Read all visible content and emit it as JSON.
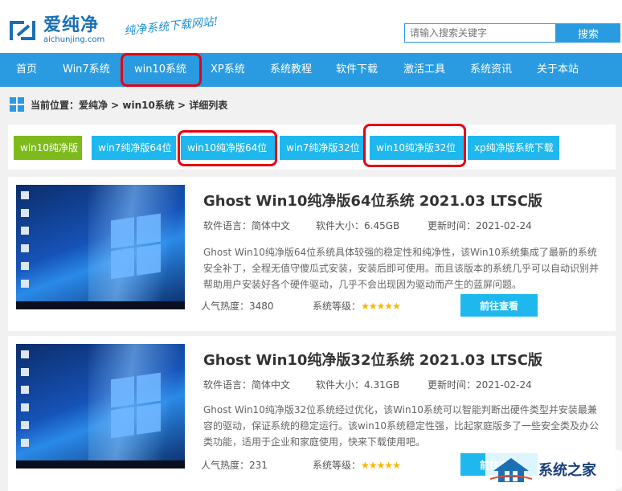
{
  "header": {
    "logo_cn": "爱纯净",
    "logo_en": "aichunjing.com",
    "slogan": "纯净系统下载网站!",
    "search_placeholder": "请输入搜索关键字",
    "search_button": "搜索"
  },
  "nav": {
    "items": [
      "首页",
      "Win7系统",
      "win10系统",
      "XP系统",
      "系统教程",
      "软件下载",
      "激活工具",
      "系统资讯",
      "关于本站"
    ],
    "active_index": 2
  },
  "breadcrumb": "当前位置：爱纯净 > win10系统 > 详细列表",
  "filters": [
    "win10纯净版",
    "win7纯净版64位",
    "win10纯净版64位",
    "win7纯净版32位",
    "win10纯净版32位",
    "xp纯净版系统下载"
  ],
  "filter_active_index": 0,
  "items": [
    {
      "title": "Ghost Win10纯净版64位系统 2021.03 LTSC版",
      "language": "软件语言：简体中文",
      "size": "软件大小：6.45GB",
      "updated": "更新时间：2021-02-24",
      "desc": "Ghost Win10纯净版64位系统具体较强的稳定性和纯净性，该Win10系统集成了最新的系统安全补丁，全程无值守傻瓜式安装，安装后即可使用。而且该版本的系统几乎可以自动识别并帮助用户安装好各个硬件驱动，几乎不会出现因为驱动而产生的蓝屏问题。",
      "heat": "人气热度：3480",
      "level_label": "系统等级：",
      "stars": "★★★★★",
      "button": "前往查看"
    },
    {
      "title": "Ghost Win10纯净版32位系统 2021.03 LTSC版",
      "language": "软件语言：简体中文",
      "size": "软件大小：4.31GB",
      "updated": "更新时间：2021-02-24",
      "desc": "Ghost Win10纯净版32位系统经过优化，该Win10系统可以智能判断出硬件类型并安装最兼容的驱动，保证系统的稳定运行。该win10系统稳定性强，比起家庭版多了一些安全类及办公类功能，适用于企业和家庭使用，快来下载使用吧。",
      "heat": "人气热度：231",
      "level_label": "系统等级：",
      "stars": "★★★★★",
      "button": "前往查看"
    }
  ],
  "watermark": "系统之家",
  "colors": {
    "accent": "#2a9be0",
    "tag": "#1fb8ee",
    "tag_active": "#7dbb1c",
    "highlight_ring": "#e60012",
    "stars": "#ffb400"
  }
}
